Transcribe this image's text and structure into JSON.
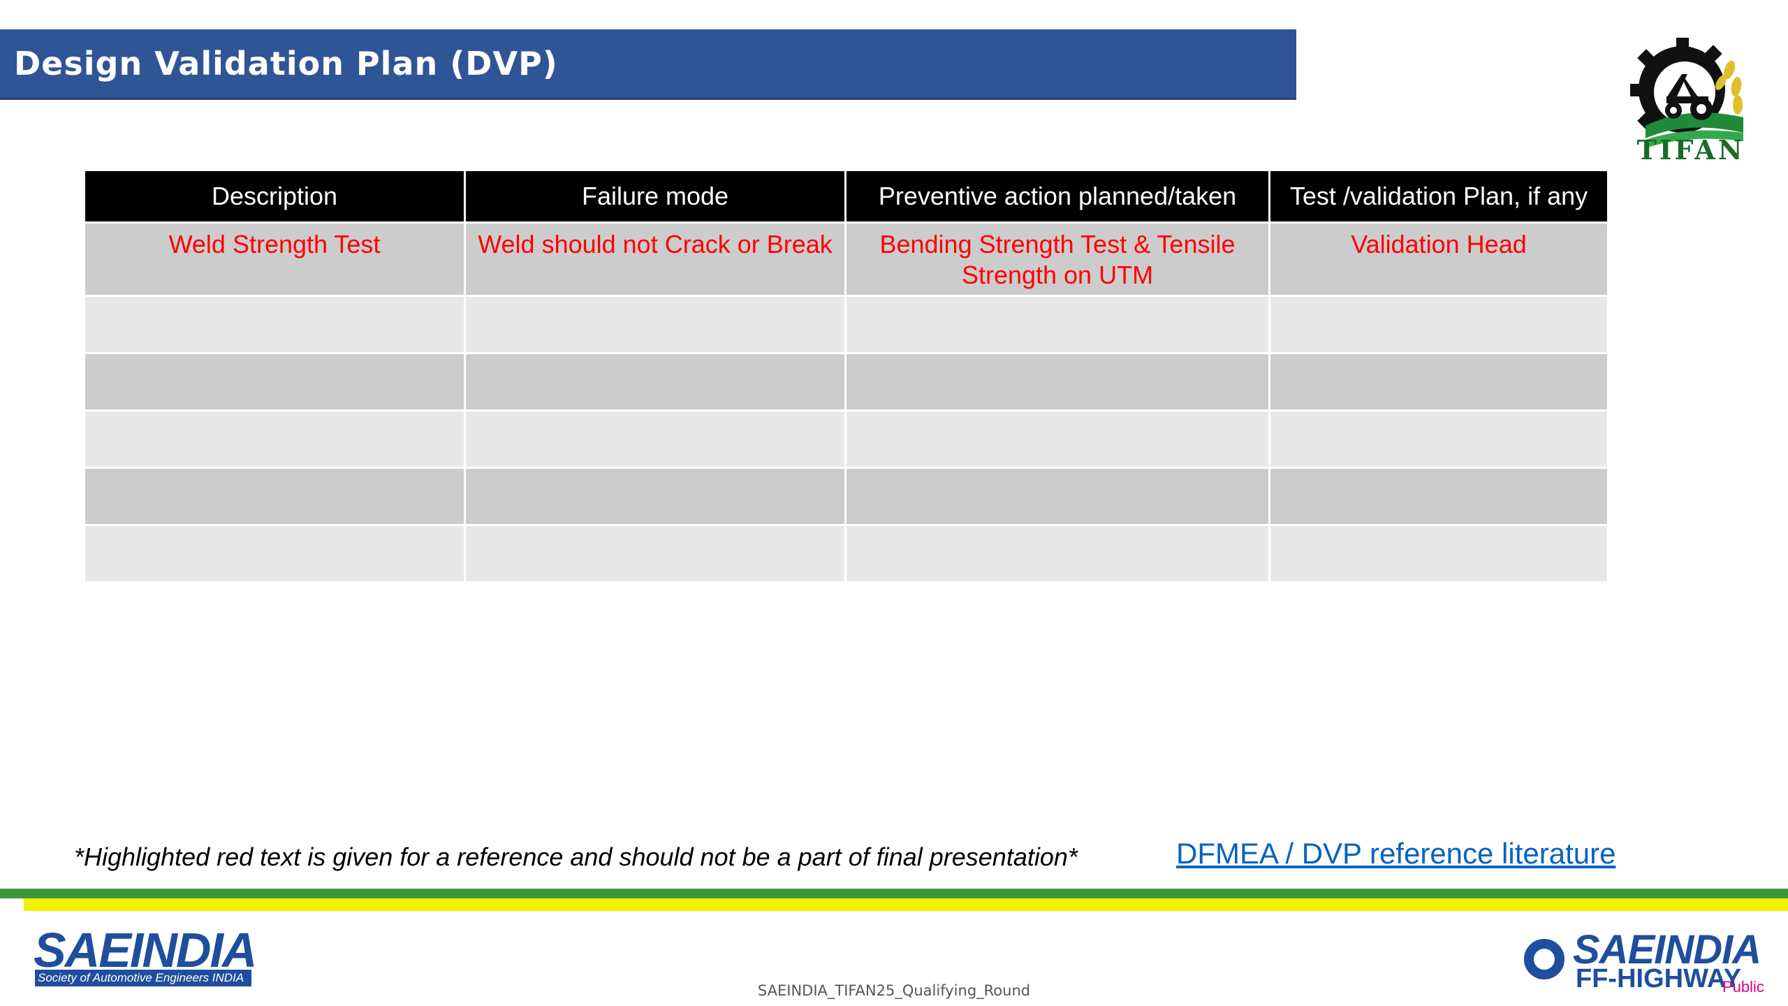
{
  "header": {
    "title": "Design Validation Plan (DVP)"
  },
  "logos": {
    "tifan_text": "TIFAN",
    "saeindia_text": "SAEINDIA",
    "saeindia_subtitle": "Society of Automotive Engineers INDIA",
    "offhighway_line1": "SAEINDIA",
    "offhighway_line2": "FF-HIGHWAY"
  },
  "table": {
    "headers": [
      "Description",
      "Failure mode",
      "Preventive action planned/taken",
      "Test /validation Plan, if any"
    ],
    "rows": [
      [
        "Weld Strength Test",
        "Weld should not Crack or Break",
        "Bending Strength Test & Tensile Strength on UTM",
        "Validation Head"
      ],
      [
        "",
        "",
        "",
        ""
      ],
      [
        "",
        "",
        "",
        ""
      ],
      [
        "",
        "",
        "",
        ""
      ],
      [
        "",
        "",
        "",
        ""
      ],
      [
        "",
        "",
        "",
        ""
      ]
    ]
  },
  "footnote": "*Highlighted red text is given for a reference and should not be a part of final presentation*",
  "reference_link": "DFMEA / DVP reference literature",
  "footer": {
    "center_text": "SAEINDIA_TIFAN25_Qualifying_Round",
    "classification": "Public"
  },
  "colors": {
    "title_bar": "#2f5597",
    "header_row": "#000000",
    "row_dark": "#cccccc",
    "row_light": "#e8e8e8",
    "reference_text": "#ff0000",
    "link": "#0563c1",
    "stripe_green": "#3a9a3a",
    "stripe_yellow": "#f2f200"
  }
}
